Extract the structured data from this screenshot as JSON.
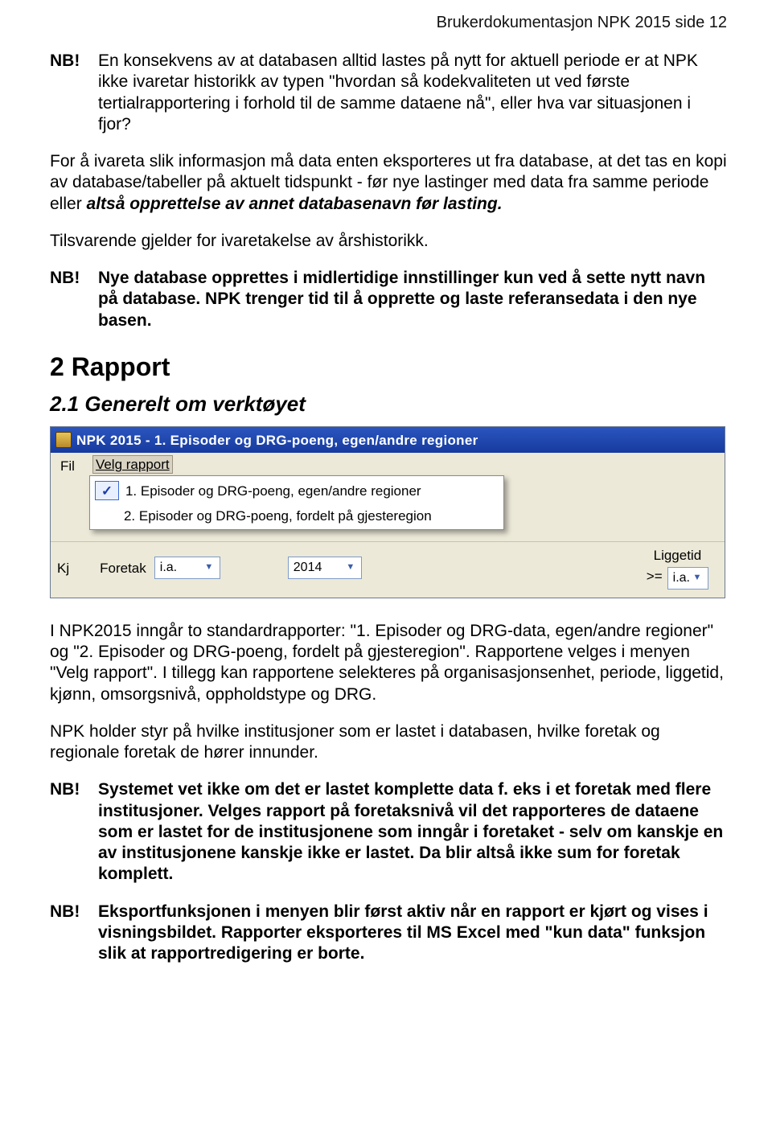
{
  "header": "Brukerdokumentasjon NPK 2015 side 12",
  "nb_label": "NB!",
  "nb1": "En konsekvens av at databasen alltid lastes på nytt for aktuell periode er at NPK ikke ivaretar historikk av typen \"hvordan så kodekvaliteten ut ved første tertialrapportering i forhold til de samme dataene nå\", eller hva var situasjonen i fjor?",
  "para2a": "For å ivareta slik informasjon må data enten eksporteres ut fra database, at det tas en kopi av database/tabeller på aktuelt tidspunkt - før nye lastinger med data fra samme periode eller ",
  "para2b": "altså opprettelse av annet databasenavn før lasting.",
  "para3": "Tilsvarende gjelder for ivaretakelse av årshistorikk.",
  "nb2": "Nye database opprettes i midlertidige innstillinger kun ved å sette nytt navn på database.  NPK trenger tid til å opprette og laste referansedata i den nye basen.",
  "h1": "2  Rapport",
  "h2": "2.1  Generelt om verktøyet",
  "shot": {
    "title": "NPK 2015 - 1.  Episoder og DRG-poeng, egen/andre regioner",
    "menu_fil": "Fil",
    "menu_velg": "Velg rapport",
    "opt1": "1.  Episoder og DRG-poeng, egen/andre regioner",
    "opt2": "2.  Episoder og DRG-poeng, fordelt på gjesteregion",
    "left_label": "Kj",
    "foretak": "Foretak",
    "ia": "i.a.",
    "year": "2014",
    "liggetid": "Liggetid",
    "gte": ">="
  },
  "para4": "I NPK2015 inngår to standardrapporter: \"1. Episoder og DRG-data, egen/andre regioner\" og \"2. Episoder og DRG-poeng, fordelt på gjesteregion\". Rapportene velges i menyen \"Velg rapport\".  I tillegg kan rapportene selekteres på organisasjonsenhet, periode, liggetid, kjønn, omsorgsnivå, oppholdstype og DRG.",
  "para5": "NPK holder styr på hvilke institusjoner som er lastet i databasen, hvilke foretak og regionale foretak de hører innunder.",
  "nb3a": "Systemet vet ikke om det er lastet komplette data f. eks i et foretak med flere institusjoner.",
  "nb3b": "  Velges rapport på foretaksnivå vil det rapporteres de dataene som er lastet for de institusjonene som inngår i foretaket - selv om kanskje en av institusjonene kanskje ikke er lastet.  Da blir altså ikke sum for foretak komplett.",
  "nb4": "Eksportfunksjonen i menyen blir først aktiv når en rapport er kjørt og vises i visningsbildet.  Rapporter eksporteres til MS Excel med \"kun data\" funksjon slik at rapportredigering er borte."
}
